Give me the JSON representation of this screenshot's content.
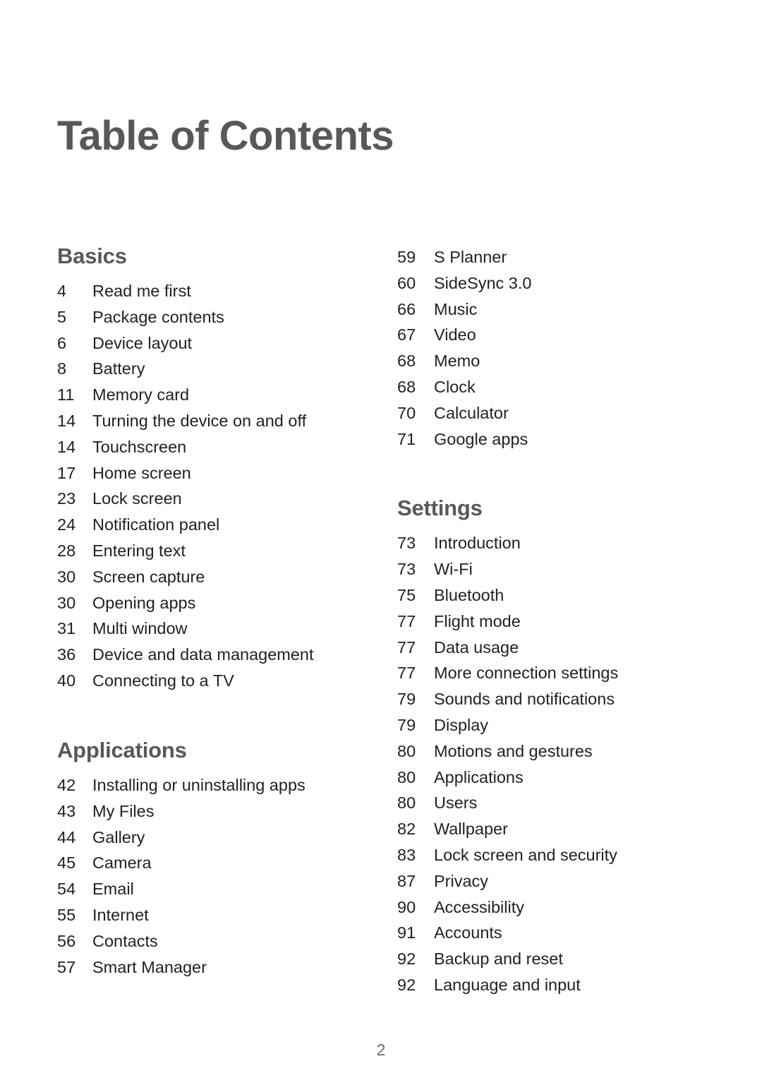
{
  "page": {
    "title": "Table of Contents",
    "folio": "2",
    "title_color": "#58585c",
    "heading_color": "#58585c",
    "body_color": "#231f20",
    "folio_color": "#6d6e71",
    "background_color": "#ffffff"
  },
  "columns": [
    {
      "name": "left-column",
      "sections": [
        {
          "heading": "Basics",
          "entries": [
            {
              "page": "4",
              "label": "Read me first"
            },
            {
              "page": "5",
              "label": "Package contents"
            },
            {
              "page": "6",
              "label": "Device layout"
            },
            {
              "page": "8",
              "label": "Battery"
            },
            {
              "page": "11",
              "label": "Memory card"
            },
            {
              "page": "14",
              "label": "Turning the device on and off"
            },
            {
              "page": "14",
              "label": "Touchscreen"
            },
            {
              "page": "17",
              "label": "Home screen"
            },
            {
              "page": "23",
              "label": "Lock screen"
            },
            {
              "page": "24",
              "label": "Notification panel"
            },
            {
              "page": "28",
              "label": "Entering text"
            },
            {
              "page": "30",
              "label": "Screen capture"
            },
            {
              "page": "30",
              "label": "Opening apps"
            },
            {
              "page": "31",
              "label": "Multi window"
            },
            {
              "page": "36",
              "label": "Device and data management"
            },
            {
              "page": "40",
              "label": "Connecting to a TV"
            }
          ]
        },
        {
          "heading": "Applications",
          "entries": [
            {
              "page": "42",
              "label": "Installing or uninstalling apps"
            },
            {
              "page": "43",
              "label": "My Files"
            },
            {
              "page": "44",
              "label": "Gallery"
            },
            {
              "page": "45",
              "label": "Camera"
            },
            {
              "page": "54",
              "label": "Email"
            },
            {
              "page": "55",
              "label": "Internet"
            },
            {
              "page": "56",
              "label": "Contacts"
            },
            {
              "page": "57",
              "label": "Smart Manager"
            }
          ]
        }
      ]
    },
    {
      "name": "right-column",
      "sections": [
        {
          "heading": "",
          "entries": [
            {
              "page": "59",
              "label": "S Planner"
            },
            {
              "page": "60",
              "label": "SideSync 3.0"
            },
            {
              "page": "66",
              "label": "Music"
            },
            {
              "page": "67",
              "label": "Video"
            },
            {
              "page": "68",
              "label": "Memo"
            },
            {
              "page": "68",
              "label": "Clock"
            },
            {
              "page": "70",
              "label": "Calculator"
            },
            {
              "page": "71",
              "label": "Google apps"
            }
          ]
        },
        {
          "heading": "Settings",
          "entries": [
            {
              "page": "73",
              "label": "Introduction"
            },
            {
              "page": "73",
              "label": "Wi-Fi"
            },
            {
              "page": "75",
              "label": "Bluetooth"
            },
            {
              "page": "77",
              "label": "Flight mode"
            },
            {
              "page": "77",
              "label": "Data usage"
            },
            {
              "page": "77",
              "label": "More connection settings"
            },
            {
              "page": "79",
              "label": "Sounds and notifications"
            },
            {
              "page": "79",
              "label": "Display"
            },
            {
              "page": "80",
              "label": "Motions and gestures"
            },
            {
              "page": "80",
              "label": "Applications"
            },
            {
              "page": "80",
              "label": "Users"
            },
            {
              "page": "82",
              "label": "Wallpaper"
            },
            {
              "page": "83",
              "label": "Lock screen and security"
            },
            {
              "page": "87",
              "label": "Privacy"
            },
            {
              "page": "90",
              "label": "Accessibility"
            },
            {
              "page": "91",
              "label": "Accounts"
            },
            {
              "page": "92",
              "label": "Backup and reset"
            },
            {
              "page": "92",
              "label": "Language and input"
            }
          ]
        }
      ]
    }
  ]
}
